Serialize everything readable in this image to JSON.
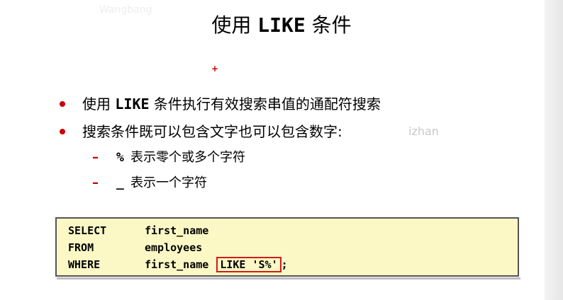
{
  "watermark_top": "Wangbang",
  "watermark_mid": "izhan",
  "title": {
    "prefix": "使用",
    "keyword": "LIKE",
    "suffix": "条件"
  },
  "marker": "+",
  "bullets": [
    {
      "prefix": "使用",
      "keyword": "LIKE",
      "suffix": "条件执行有效搜索串值的通配符搜索"
    },
    {
      "text": "搜索条件既可以包含文字也可以包含数字:"
    }
  ],
  "sub_items": [
    {
      "dash": "–",
      "symbol": "%",
      "text": "表示零个或多个字符"
    },
    {
      "dash": "–",
      "symbol": "_",
      "text": "表示一个字符"
    }
  ],
  "code": {
    "lines": [
      {
        "keyword": "SELECT",
        "rest": "first_name",
        "highlight": ""
      },
      {
        "keyword": "FROM",
        "rest": "employees",
        "highlight": ""
      },
      {
        "keyword": "WHERE",
        "rest": "first_name ",
        "highlight": "LIKE 'S%'",
        "tail": ";"
      }
    ]
  },
  "colors": {
    "bullet": "#cc0000",
    "code_bg": "#fbf8c6",
    "highlight_border": "#d41a1a"
  }
}
